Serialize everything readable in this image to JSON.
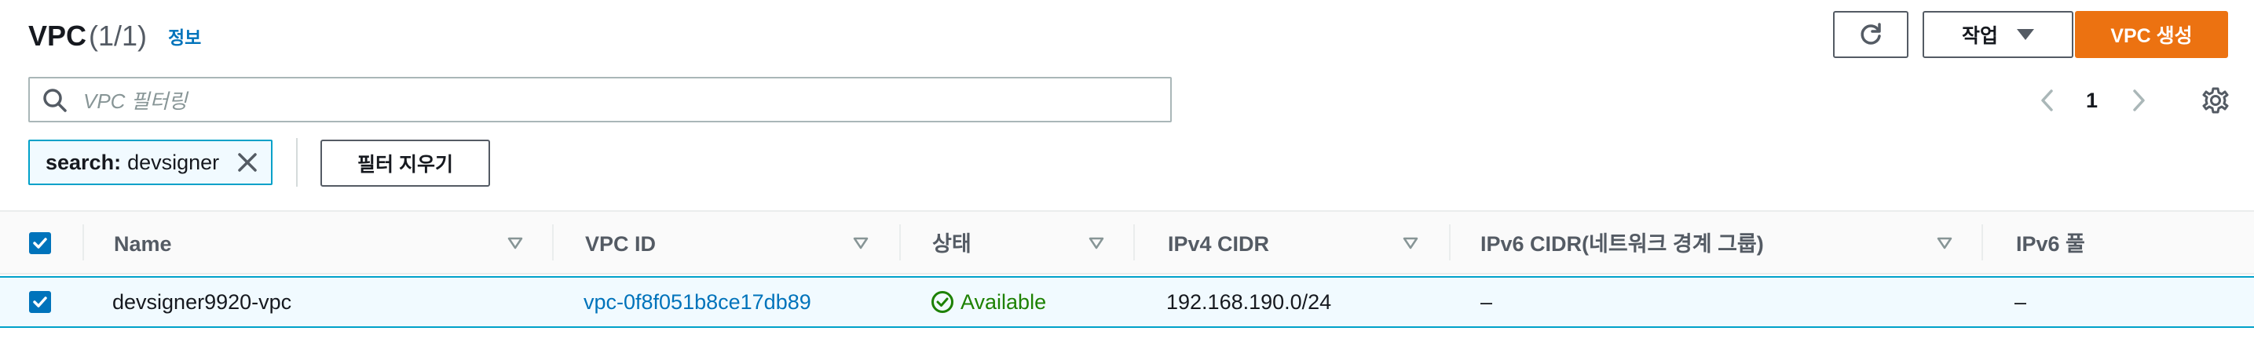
{
  "header": {
    "title": "VPC",
    "count": "(1/1)",
    "info_link": "정보",
    "actions_label": "작업",
    "create_label": "VPC 생성"
  },
  "search": {
    "placeholder": "VPC 필터링",
    "token_key": "search:",
    "token_value": "devsigner",
    "clear_label": "필터 지우기"
  },
  "pagination": {
    "current_page": "1"
  },
  "table": {
    "columns": [
      "Name",
      "VPC ID",
      "상태",
      "IPv4 CIDR",
      "IPv6 CIDR(네트워크 경계 그룹)",
      "IPv6 풀"
    ],
    "rows": [
      {
        "selected": true,
        "name": "devsigner9920-vpc",
        "vpc_id": "vpc-0f8f051b8ce17db89",
        "status": "Available",
        "ipv4_cidr": "192.168.190.0/24",
        "ipv6_cidr": "–",
        "ipv6_pool": "–"
      }
    ]
  },
  "colors": {
    "accent": "#ec7211",
    "link": "#0073bb",
    "success": "#1d8102",
    "selection": "#f1faff"
  }
}
